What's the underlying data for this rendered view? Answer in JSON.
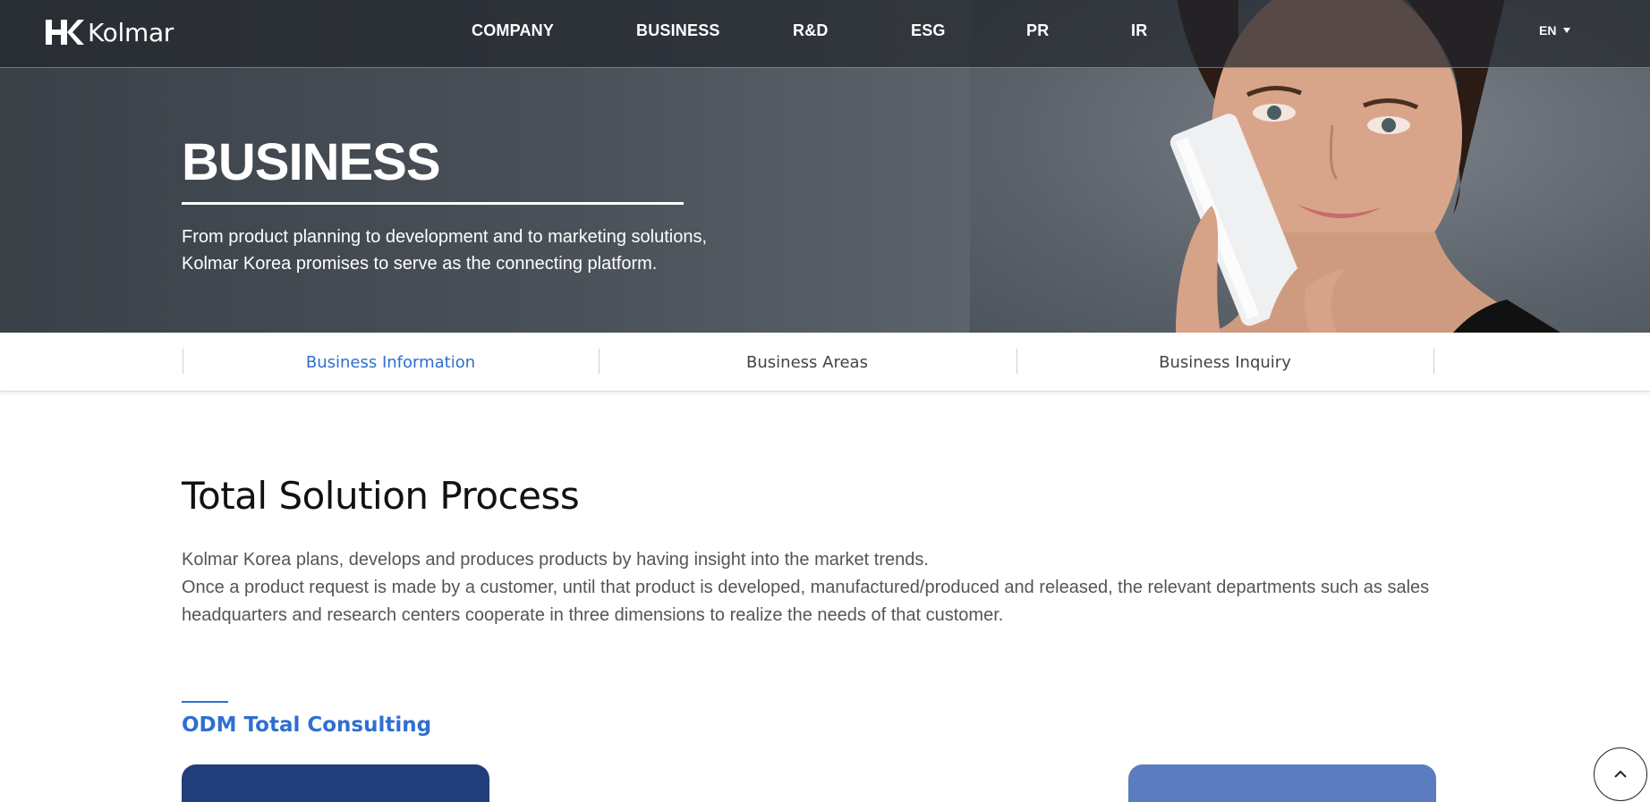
{
  "brand": {
    "name": "Kolmar"
  },
  "nav": {
    "items": [
      {
        "label": "COMPANY"
      },
      {
        "label": "BUSINESS"
      },
      {
        "label": "R&D"
      },
      {
        "label": "ESG"
      },
      {
        "label": "PR"
      },
      {
        "label": "IR"
      }
    ],
    "lang": "EN"
  },
  "hero": {
    "title": "BUSINESS",
    "desc_line1": "From product planning to development and to marketing solutions,",
    "desc_line2": "Kolmar Korea promises to serve as the connecting platform."
  },
  "subtabs": {
    "items": [
      {
        "label": "Business Information",
        "active": true
      },
      {
        "label": "Business Areas",
        "active": false
      },
      {
        "label": "Business Inquiry",
        "active": false
      }
    ]
  },
  "content": {
    "title": "Total Solution Process",
    "desc_line1": "Kolmar Korea plans, develops and produces products by having insight into the market trends.",
    "desc_line2": "Once a product request is made by a customer, until that product is developed, manufactured/produced and released, the relevant departments such as sales",
    "desc_line3": "headquarters and research centers cooperate in three dimensions to realize the needs of that customer.",
    "subsection_title": "ODM Total Consulting"
  },
  "icons": {
    "lang_caret": "caret-down-icon",
    "scroll_top": "chevron-up-icon"
  },
  "colors": {
    "accent": "#2f6fd0",
    "card_dark": "#213e7a",
    "card_light": "#5c7cc0"
  }
}
